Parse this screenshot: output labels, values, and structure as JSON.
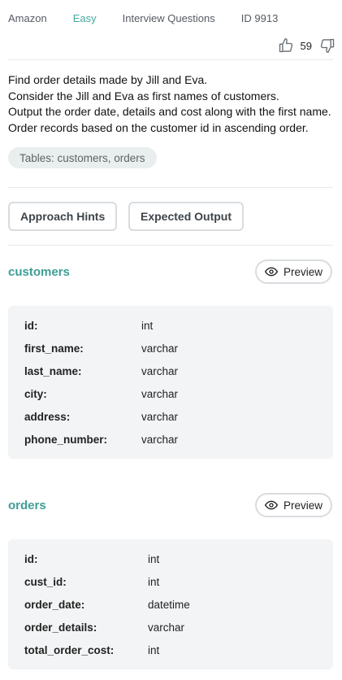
{
  "meta": {
    "company": "Amazon",
    "difficulty": "Easy",
    "category": "Interview Questions",
    "id_label": "ID 9913"
  },
  "votes": {
    "count": "59",
    "upvote_icon": "thumbs-up-icon",
    "downvote_icon": "thumbs-down-icon"
  },
  "description": [
    "Find order details made by Jill and Eva.",
    "Consider the Jill and Eva as first names of customers.",
    "Output the order date, details and cost along with the first name.",
    "Order records based on the customer id in ascending order."
  ],
  "tables_chip": "Tables: customers, orders",
  "buttons": {
    "hints": "Approach Hints",
    "expected": "Expected Output",
    "preview": "Preview"
  },
  "tables": [
    {
      "name": "customers",
      "columns": [
        {
          "name": "id:",
          "type": "int"
        },
        {
          "name": "first_name:",
          "type": "varchar"
        },
        {
          "name": "last_name:",
          "type": "varchar"
        },
        {
          "name": "city:",
          "type": "varchar"
        },
        {
          "name": "address:",
          "type": "varchar"
        },
        {
          "name": "phone_number:",
          "type": "varchar"
        }
      ]
    },
    {
      "name": "orders",
      "columns": [
        {
          "name": "id:",
          "type": "int"
        },
        {
          "name": "cust_id:",
          "type": "int"
        },
        {
          "name": "order_date:",
          "type": "datetime"
        },
        {
          "name": "order_details:",
          "type": "varchar"
        },
        {
          "name": "total_order_cost:",
          "type": "int"
        }
      ]
    }
  ],
  "colors": {
    "accent": "#3e9e96",
    "difficulty": "#46a89e"
  }
}
